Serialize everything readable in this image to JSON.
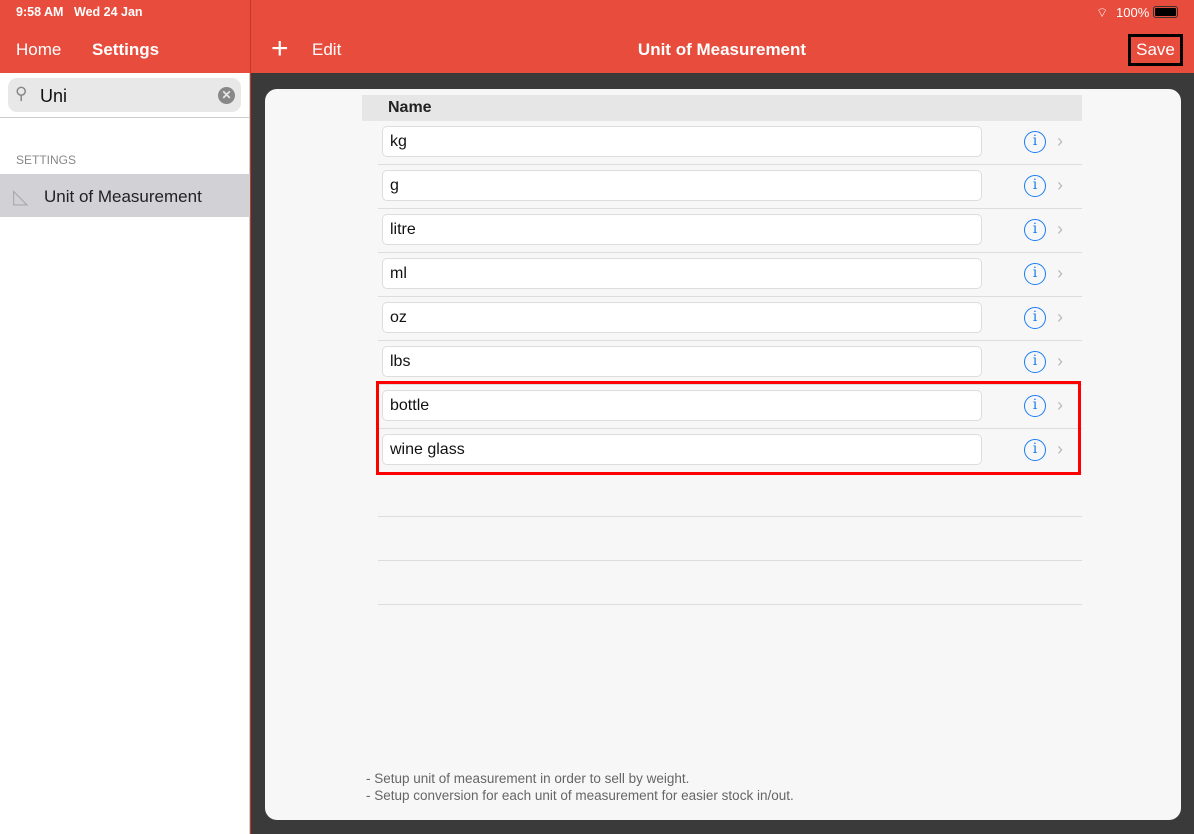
{
  "status": {
    "time": "9:58 AM",
    "date": "Wed 24 Jan",
    "battery": "100%"
  },
  "sidebar": {
    "home": "Home",
    "title": "Settings",
    "search_value": "Uni",
    "section": "SETTINGS",
    "items": [
      {
        "label": "Unit of Measurement",
        "icon": "set-square-icon"
      }
    ]
  },
  "main": {
    "add": "+",
    "edit": "Edit",
    "title": "Unit of Measurement",
    "save": "Save",
    "column": "Name",
    "rows": [
      "kg",
      "g",
      "litre",
      "ml",
      "oz",
      "lbs",
      "bottle",
      "wine glass"
    ],
    "notes": [
      "- Setup unit of measurement in order to sell by weight.",
      "- Setup conversion for each unit of measurement for easier stock in/out."
    ],
    "highlight_color": "#ff0000",
    "accent": "#e84c3d"
  }
}
